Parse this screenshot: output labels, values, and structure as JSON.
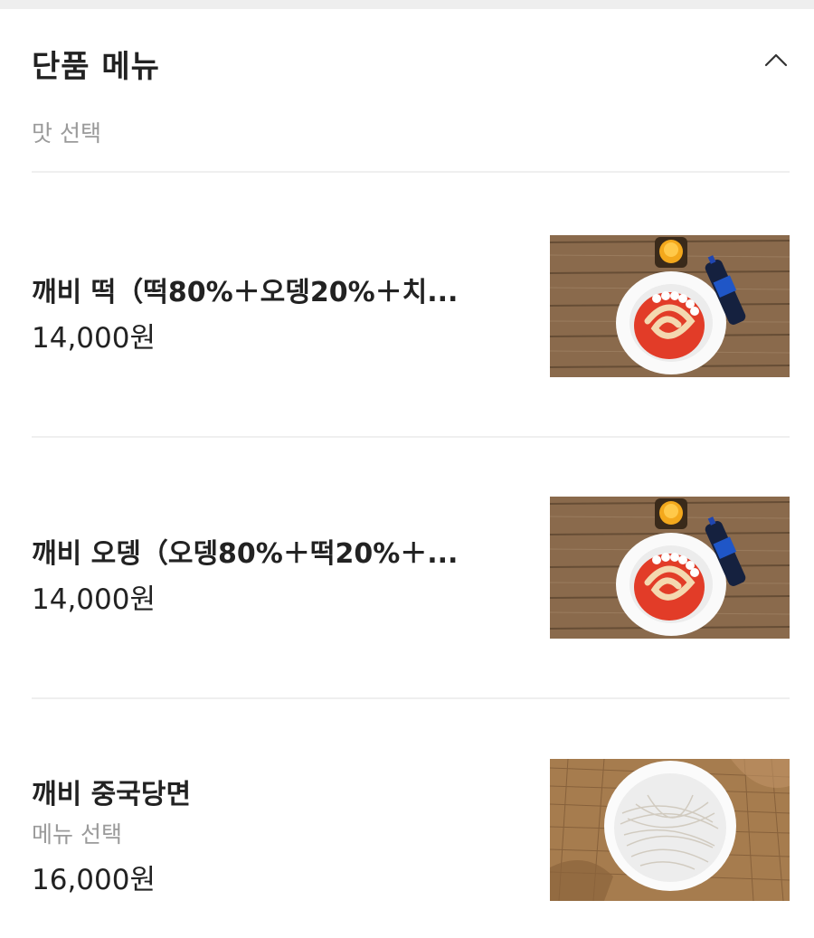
{
  "section": {
    "title": "단품 메뉴",
    "subtitle": "맛 선택",
    "toggle_icon": "chevron-up-icon"
  },
  "items": [
    {
      "name": "깨비 떡（떡80%＋오뎅20%＋치...",
      "desc": "",
      "price": "14,000원",
      "image": "tteokbokki-bowl-with-cola"
    },
    {
      "name": "깨비 오뎅（오뎅80%＋떡20%＋...",
      "desc": "",
      "price": "14,000원",
      "image": "tteokbokki-bowl-with-cola"
    },
    {
      "name": "깨비 중국당면",
      "desc": "메뉴 선택",
      "price": "16,000원",
      "image": "glass-noodles-bowl-on-burlap"
    }
  ]
}
